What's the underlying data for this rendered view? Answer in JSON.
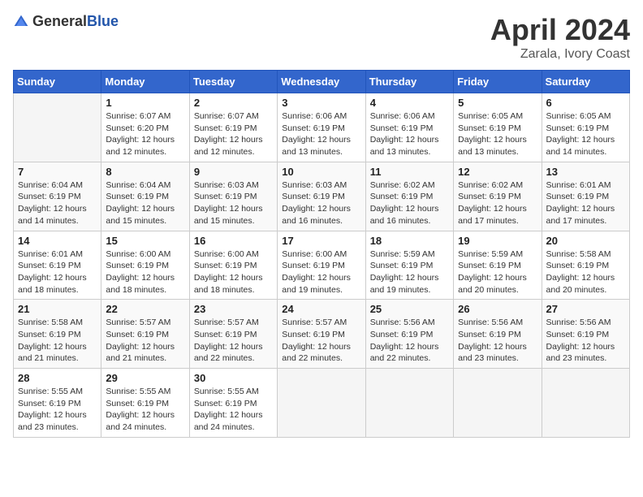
{
  "header": {
    "logo_general": "General",
    "logo_blue": "Blue",
    "month_title": "April 2024",
    "location": "Zarala, Ivory Coast"
  },
  "weekdays": [
    "Sunday",
    "Monday",
    "Tuesday",
    "Wednesday",
    "Thursday",
    "Friday",
    "Saturday"
  ],
  "weeks": [
    [
      {
        "day": "",
        "info": ""
      },
      {
        "day": "1",
        "info": "Sunrise: 6:07 AM\nSunset: 6:20 PM\nDaylight: 12 hours\nand 12 minutes."
      },
      {
        "day": "2",
        "info": "Sunrise: 6:07 AM\nSunset: 6:19 PM\nDaylight: 12 hours\nand 12 minutes."
      },
      {
        "day": "3",
        "info": "Sunrise: 6:06 AM\nSunset: 6:19 PM\nDaylight: 12 hours\nand 13 minutes."
      },
      {
        "day": "4",
        "info": "Sunrise: 6:06 AM\nSunset: 6:19 PM\nDaylight: 12 hours\nand 13 minutes."
      },
      {
        "day": "5",
        "info": "Sunrise: 6:05 AM\nSunset: 6:19 PM\nDaylight: 12 hours\nand 13 minutes."
      },
      {
        "day": "6",
        "info": "Sunrise: 6:05 AM\nSunset: 6:19 PM\nDaylight: 12 hours\nand 14 minutes."
      }
    ],
    [
      {
        "day": "7",
        "info": "Sunrise: 6:04 AM\nSunset: 6:19 PM\nDaylight: 12 hours\nand 14 minutes."
      },
      {
        "day": "8",
        "info": "Sunrise: 6:04 AM\nSunset: 6:19 PM\nDaylight: 12 hours\nand 15 minutes."
      },
      {
        "day": "9",
        "info": "Sunrise: 6:03 AM\nSunset: 6:19 PM\nDaylight: 12 hours\nand 15 minutes."
      },
      {
        "day": "10",
        "info": "Sunrise: 6:03 AM\nSunset: 6:19 PM\nDaylight: 12 hours\nand 16 minutes."
      },
      {
        "day": "11",
        "info": "Sunrise: 6:02 AM\nSunset: 6:19 PM\nDaylight: 12 hours\nand 16 minutes."
      },
      {
        "day": "12",
        "info": "Sunrise: 6:02 AM\nSunset: 6:19 PM\nDaylight: 12 hours\nand 17 minutes."
      },
      {
        "day": "13",
        "info": "Sunrise: 6:01 AM\nSunset: 6:19 PM\nDaylight: 12 hours\nand 17 minutes."
      }
    ],
    [
      {
        "day": "14",
        "info": "Sunrise: 6:01 AM\nSunset: 6:19 PM\nDaylight: 12 hours\nand 18 minutes."
      },
      {
        "day": "15",
        "info": "Sunrise: 6:00 AM\nSunset: 6:19 PM\nDaylight: 12 hours\nand 18 minutes."
      },
      {
        "day": "16",
        "info": "Sunrise: 6:00 AM\nSunset: 6:19 PM\nDaylight: 12 hours\nand 18 minutes."
      },
      {
        "day": "17",
        "info": "Sunrise: 6:00 AM\nSunset: 6:19 PM\nDaylight: 12 hours\nand 19 minutes."
      },
      {
        "day": "18",
        "info": "Sunrise: 5:59 AM\nSunset: 6:19 PM\nDaylight: 12 hours\nand 19 minutes."
      },
      {
        "day": "19",
        "info": "Sunrise: 5:59 AM\nSunset: 6:19 PM\nDaylight: 12 hours\nand 20 minutes."
      },
      {
        "day": "20",
        "info": "Sunrise: 5:58 AM\nSunset: 6:19 PM\nDaylight: 12 hours\nand 20 minutes."
      }
    ],
    [
      {
        "day": "21",
        "info": "Sunrise: 5:58 AM\nSunset: 6:19 PM\nDaylight: 12 hours\nand 21 minutes."
      },
      {
        "day": "22",
        "info": "Sunrise: 5:57 AM\nSunset: 6:19 PM\nDaylight: 12 hours\nand 21 minutes."
      },
      {
        "day": "23",
        "info": "Sunrise: 5:57 AM\nSunset: 6:19 PM\nDaylight: 12 hours\nand 22 minutes."
      },
      {
        "day": "24",
        "info": "Sunrise: 5:57 AM\nSunset: 6:19 PM\nDaylight: 12 hours\nand 22 minutes."
      },
      {
        "day": "25",
        "info": "Sunrise: 5:56 AM\nSunset: 6:19 PM\nDaylight: 12 hours\nand 22 minutes."
      },
      {
        "day": "26",
        "info": "Sunrise: 5:56 AM\nSunset: 6:19 PM\nDaylight: 12 hours\nand 23 minutes."
      },
      {
        "day": "27",
        "info": "Sunrise: 5:56 AM\nSunset: 6:19 PM\nDaylight: 12 hours\nand 23 minutes."
      }
    ],
    [
      {
        "day": "28",
        "info": "Sunrise: 5:55 AM\nSunset: 6:19 PM\nDaylight: 12 hours\nand 23 minutes."
      },
      {
        "day": "29",
        "info": "Sunrise: 5:55 AM\nSunset: 6:19 PM\nDaylight: 12 hours\nand 24 minutes."
      },
      {
        "day": "30",
        "info": "Sunrise: 5:55 AM\nSunset: 6:19 PM\nDaylight: 12 hours\nand 24 minutes."
      },
      {
        "day": "",
        "info": ""
      },
      {
        "day": "",
        "info": ""
      },
      {
        "day": "",
        "info": ""
      },
      {
        "day": "",
        "info": ""
      }
    ]
  ]
}
